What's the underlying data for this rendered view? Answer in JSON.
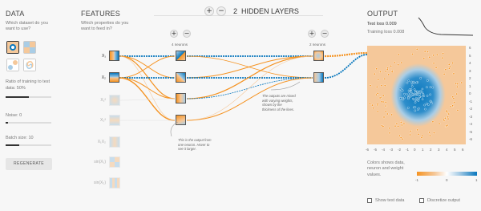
{
  "data_panel": {
    "title": "DATA",
    "dataset_prompt": "Which dataset do you want to use?",
    "ratio_label_line1": "Ratio of training to test",
    "ratio_label_line2": "data:",
    "ratio_value": "50%",
    "ratio_fraction": 0.5,
    "noise_label": "Noise:",
    "noise_value": "0",
    "noise_fraction": 0.0,
    "batch_label": "Batch size:",
    "batch_value": "10",
    "batch_fraction": 0.3,
    "regenerate_label": "REGENERATE"
  },
  "features_panel": {
    "title": "FEATURES",
    "prompt": "Which properties do you want to feed in?",
    "features": [
      {
        "label": "X₁",
        "active": true
      },
      {
        "label": "X₂",
        "active": true
      },
      {
        "label": "X₁²",
        "active": false
      },
      {
        "label": "X₂²",
        "active": false
      },
      {
        "label": "X₁X₂",
        "active": false
      },
      {
        "label": "sin(X₁)",
        "active": false
      },
      {
        "label": "sin(X₂)",
        "active": false
      }
    ]
  },
  "network": {
    "layer_count": "2",
    "hidden_layers_label": "HIDDEN LAYERS",
    "layer1_neurons_label": "4 neurons",
    "layer2_neurons_label": "2 neurons",
    "note_output_line1": "This is the output from",
    "note_output_line2": "one neuron. Hover to",
    "note_output_line3": "see it larger.",
    "note_weights_line1": "The outputs are mixed",
    "note_weights_line2": "with varying weights,",
    "note_weights_line3": "shown by the",
    "note_weights_line4": "thickness of the lines."
  },
  "output_panel": {
    "title": "OUTPUT",
    "test_loss_label": "Test loss",
    "test_loss_value": "0.009",
    "training_loss_label": "Training loss",
    "training_loss_value": "0.008",
    "x_ticks": [
      "-6",
      "-5",
      "-4",
      "-3",
      "-2",
      "-1",
      "0",
      "1",
      "2",
      "3",
      "4",
      "5",
      "6"
    ],
    "y_ticks": [
      "6",
      "5",
      "4",
      "3",
      "2",
      "1",
      "0",
      "-1",
      "-2",
      "-3",
      "-4",
      "-5",
      "-6"
    ],
    "legend_text_line1": "Colors shows data,",
    "legend_text_line2": "neuron and weight",
    "legend_text_line3": "values.",
    "legend_ticks": [
      "-1",
      "0",
      "1"
    ],
    "show_test_data_label": "Show test data",
    "discretize_label": "Discretize output"
  },
  "colors": {
    "orange": "#f59322",
    "blue": "#0877bd",
    "light_orange": "#f5c89a",
    "light_blue": "#a9cde6"
  }
}
